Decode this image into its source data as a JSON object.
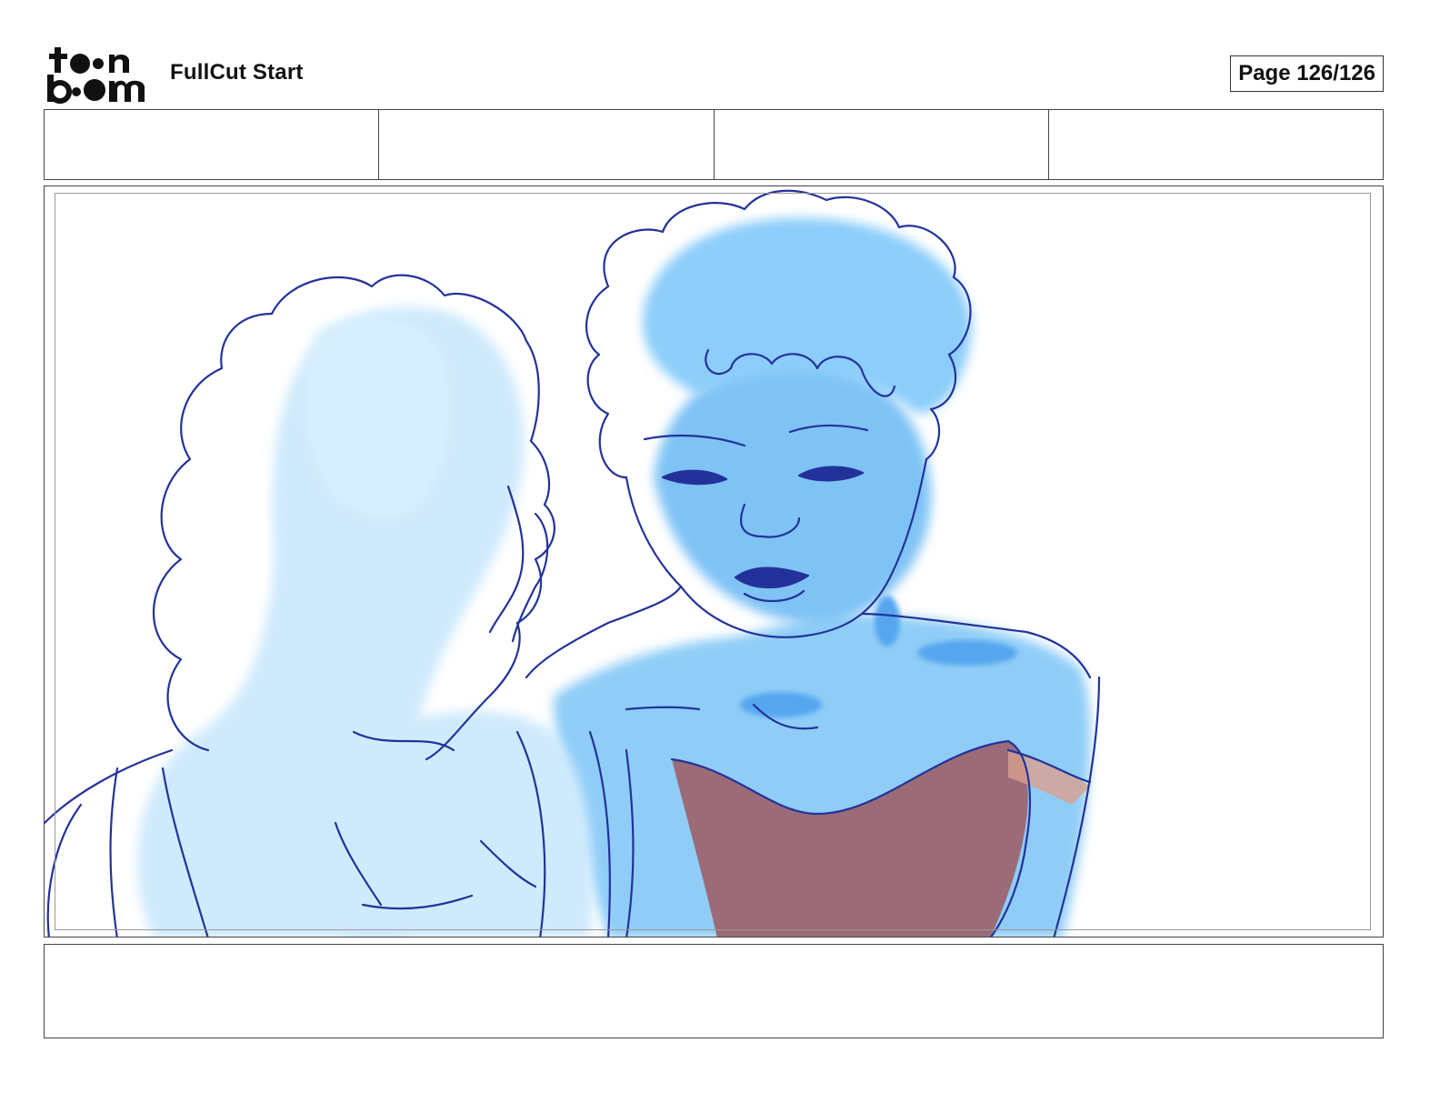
{
  "logo": {
    "line1": "toon",
    "line2": "boom",
    "icon": "toonboom-logo"
  },
  "header": {
    "title": "FullCut Start",
    "page_label": "Page 126/126"
  },
  "header_cells": [
    "",
    "",
    "",
    ""
  ],
  "panel": {
    "image": "storyboard-panel-sketch"
  },
  "caption": {
    "text": ""
  },
  "colors": {
    "sketch_line": "#23329a",
    "light_blue": "#cfeafc",
    "mid_blue": "#8fcdf7",
    "deep_blue": "#54a6ef",
    "dress": "#9b6b77"
  }
}
